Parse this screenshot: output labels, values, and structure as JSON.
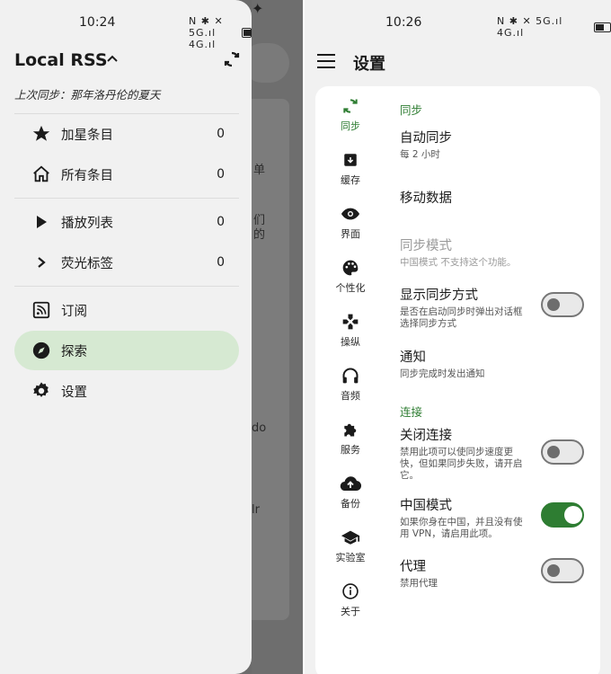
{
  "left": {
    "status": {
      "time": "10:24",
      "icons": "N ✱ ✕ 5G.ıl 4G.ıl"
    },
    "app_title": "Local RSS",
    "last_sync": "上次同步：那年洛丹伦的夏天",
    "nav": [
      {
        "label": "加星条目",
        "count": "0",
        "icon": "star-icon"
      },
      {
        "label": "所有条目",
        "count": "0",
        "icon": "home-icon"
      },
      {
        "label": "播放列表",
        "count": "0",
        "icon": "play-icon"
      },
      {
        "label": "荧光标签",
        "count": "0",
        "icon": "chevron-right-icon"
      },
      {
        "label": "订阅",
        "icon": "rss-icon"
      },
      {
        "label": "探索",
        "icon": "compass-icon",
        "active": true
      },
      {
        "label": "设置",
        "icon": "gear-icon"
      }
    ],
    "behind_texts": [
      "单",
      "们",
      "的",
      "do",
      "lr"
    ]
  },
  "right": {
    "status": {
      "time": "10:26",
      "icons": "N ✱ ✕ 5G.ıl 4G.ıl"
    },
    "title": "设置",
    "rail": [
      {
        "label": "同步",
        "icon": "sync-icon",
        "active": true
      },
      {
        "label": "缓存",
        "icon": "archive-icon"
      },
      {
        "label": "界面",
        "icon": "eye-icon"
      },
      {
        "label": "个性化",
        "icon": "palette-icon"
      },
      {
        "label": "操纵",
        "icon": "gamepad-icon"
      },
      {
        "label": "音频",
        "icon": "headphones-icon"
      },
      {
        "label": "服务",
        "icon": "puzzle-icon"
      },
      {
        "label": "备份",
        "icon": "cloud-upload-icon"
      },
      {
        "label": "实验室",
        "icon": "school-icon"
      },
      {
        "label": "关于",
        "icon": "info-icon"
      }
    ],
    "sections": {
      "sync": "同步",
      "connection": "连接"
    },
    "settings": {
      "auto_sync": {
        "title": "自动同步",
        "subtitle": "每 2 小时"
      },
      "mobile_data": {
        "title": "移动数据"
      },
      "sync_mode": {
        "title": "同步模式",
        "subtitle": "中国模式 不支持这个功能。"
      },
      "show_sync_method": {
        "title": "显示同步方式",
        "subtitle": "是否在启动同步时弹出对话框选择同步方式",
        "on": false
      },
      "notification": {
        "title": "通知",
        "subtitle": "同步完成时发出通知"
      },
      "close_connection": {
        "title": "关闭连接",
        "subtitle": "禁用此项可以使同步速度更快，但如果同步失败，请开启它。",
        "on": false
      },
      "china_mode": {
        "title": "中国模式",
        "subtitle": "如果你身在中国，并且没有使用 VPN，请启用此项。",
        "on": true
      },
      "proxy": {
        "title": "代理",
        "subtitle": "禁用代理",
        "on": false
      }
    },
    "accent_color": "#2e7d32"
  }
}
